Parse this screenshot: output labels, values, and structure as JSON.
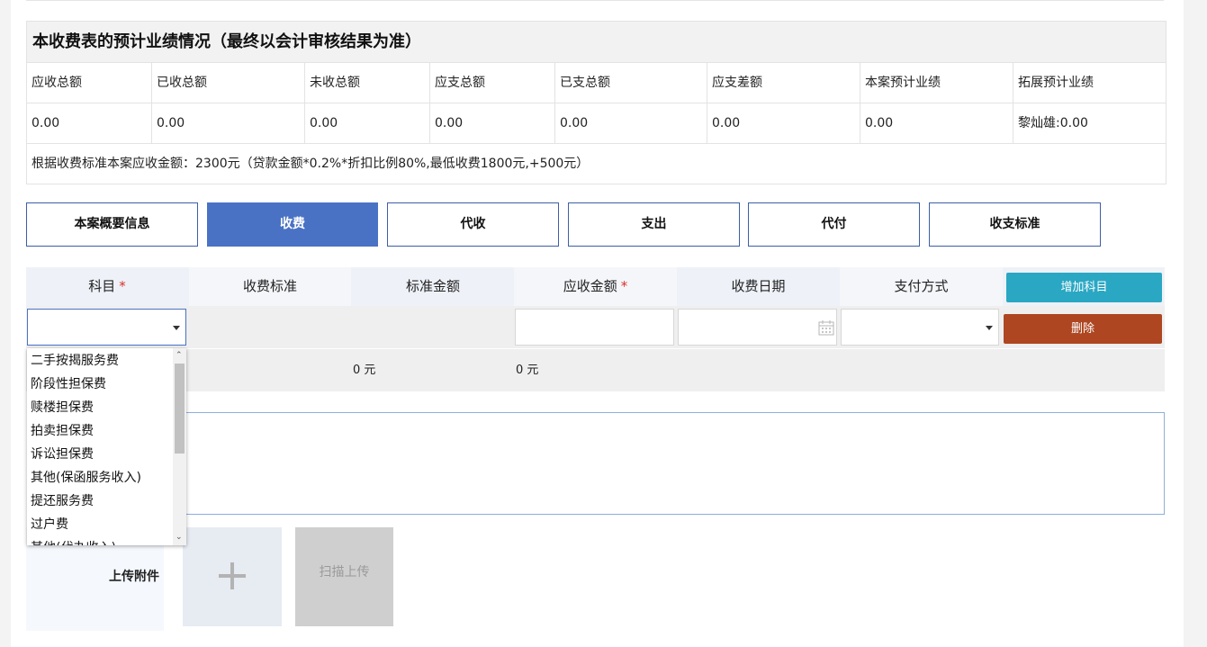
{
  "summary": {
    "title": "本收费表的预计业绩情况（最终以会计审核结果为准）",
    "headers": [
      "应收总额",
      "已收总额",
      "未收总额",
      "应支总额",
      "已支总额",
      "应支差额",
      "本案预计业绩",
      "拓展预计业绩"
    ],
    "values": [
      "0.00",
      "0.00",
      "0.00",
      "0.00",
      "0.00",
      "0.00",
      "0.00",
      "黎灿雄:0.00"
    ],
    "note": "根据收费标准本案应收金额：2300元（贷款金额*0.2%*折扣比例80%,最低收费1800元,+500元）"
  },
  "tabs": [
    "本案概要信息",
    "收费",
    "代收",
    "支出",
    "代付",
    "收支标准"
  ],
  "active_tab": "收费",
  "fee_table": {
    "headers": [
      "科目",
      "收费标准",
      "标准金额",
      "应收金额",
      "收费日期",
      "支付方式"
    ],
    "add_button": "增加科目",
    "delete_button": "删除",
    "required_mark": "*",
    "totals": [
      "0 元",
      "0 元"
    ]
  },
  "dropdown": {
    "items": [
      "二手按揭服务费",
      "阶段性担保费",
      "赎楼担保费",
      "拍卖担保费",
      "诉讼担保费",
      "其他(保函服务收入)",
      "提还服务费",
      "过户费",
      "其他(代办收入)"
    ]
  },
  "upload": {
    "label": "上传附件",
    "scan_label": "扫描上传"
  },
  "colors": {
    "tab_active": "#4a72c4",
    "add_button": "#2aa7c3",
    "delete_button": "#ae4622",
    "required": "#d9302b"
  }
}
